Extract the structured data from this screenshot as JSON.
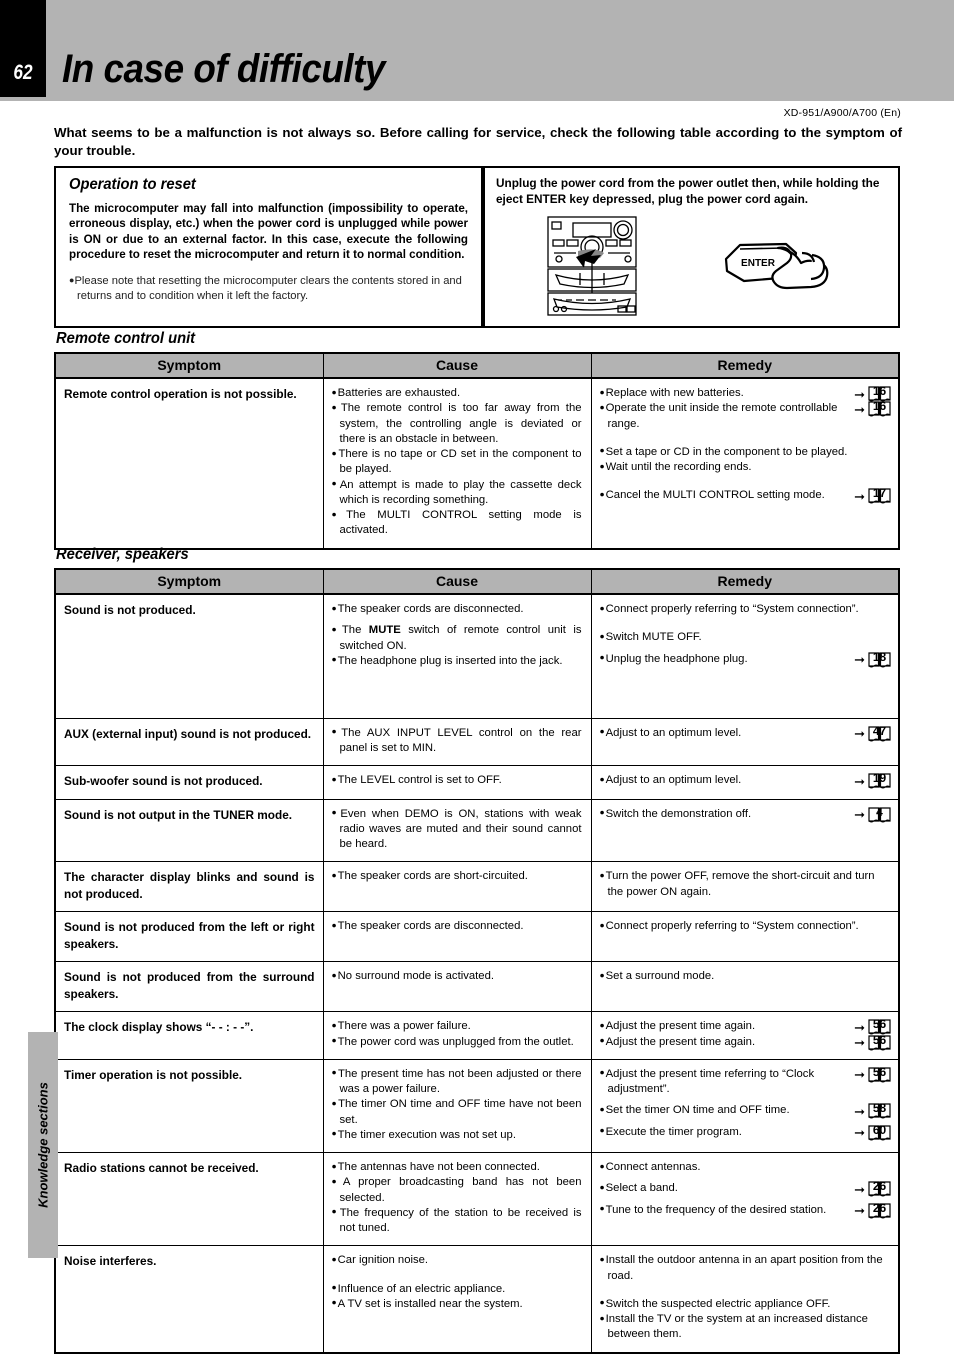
{
  "header": {
    "page_number": "62",
    "title": "In case of difficulty",
    "model_line": "XD-951/A900/A700 (En)"
  },
  "intro": "What seems to be a malfunction is not always so.  Before calling for service, check the following table according to the symptom of your trouble.",
  "reset_panel": {
    "heading": "Operation to reset",
    "body": "The microcomputer may fall into malfunction (impossibility to operate, erroneous display, etc.) when the power cord is unplugged while power is ON or due to an external factor. In this case, execute the following procedure to reset the microcomputer and return it to normal condition.",
    "note": "Please note that resetting the microcomputer clears the contents stored in and returns and to condition when it left the factory.",
    "instruction": "Unplug the power cord from the power outlet then, while holding the eject ENTER key depressed, plug the power cord again.",
    "enter_key_label": "ENTER"
  },
  "side_tab": {
    "label": "Knowledge sections"
  },
  "columns": {
    "symptom": "Symptom",
    "cause": "Cause",
    "remedy": "Remedy"
  },
  "sections": [
    {
      "heading": "Remote control unit",
      "rows": [
        {
          "symptom": "Remote control operation is not possible.",
          "causes": [
            "Batteries are exhausted.",
            "The remote control is too far away from the system, the controlling angle is deviated or there is an obstacle in between.",
            "There is no tape or CD set in the component to be played.",
            "An attempt is made to play the cassette deck which is recording something.",
            "The MULTI CONTROL setting mode is activated."
          ],
          "remedies": [
            {
              "text": "Replace with new batteries.",
              "page": "16"
            },
            {
              "text": "Operate the unit inside the remote controllable range.",
              "page": "16"
            },
            {
              "text": "Set a tape or CD in the component to be played.",
              "page": ""
            },
            {
              "text": "Wait until the recording ends.",
              "page": ""
            },
            {
              "text": "Cancel the MULTI CONTROL setting mode.",
              "page": "17"
            }
          ]
        }
      ]
    },
    {
      "heading": "Receiver, speakers",
      "rows": [
        {
          "symptom": "Sound is not produced.",
          "causes": [
            "The speaker cords are disconnected.",
            "The MUTE switch of remote control unit is switched ON.",
            "The headphone plug is inserted into the jack."
          ],
          "remedies": [
            {
              "text": "Connect properly referring to “System connection”.",
              "page": ""
            },
            {
              "text": "Switch MUTE OFF.",
              "page": ""
            },
            {
              "text": "Unplug the headphone plug.",
              "page": "18"
            }
          ]
        },
        {
          "symptom": "AUX (external input) sound is not produced.",
          "causes": [
            "The AUX INPUT LEVEL control on the rear panel is set to MIN."
          ],
          "remedies": [
            {
              "text": "Adjust to an optimum level.",
              "page": "47"
            }
          ]
        },
        {
          "symptom": "Sub-woofer sound is not produced.",
          "causes": [
            "The LEVEL control is set to OFF."
          ],
          "remedies": [
            {
              "text": "Adjust to an optimum level.",
              "page": "19"
            }
          ]
        },
        {
          "symptom": "Sound is not output in the TUNER mode.",
          "causes": [
            "Even when DEMO is ON, stations with weak radio waves are muted and their sound cannot be heard."
          ],
          "remedies": [
            {
              "text": "Switch the demonstration off.",
              "page": "4"
            }
          ]
        },
        {
          "symptom": "The character display blinks and sound is not produced.",
          "causes": [
            "The speaker cords are short-circuited."
          ],
          "remedies": [
            {
              "text": "Turn the power OFF, remove the short-circuit  and turn the power ON again.",
              "page": ""
            }
          ]
        },
        {
          "symptom": "Sound is not produced from the left or right speakers.",
          "causes": [
            "The speaker cords are disconnected."
          ],
          "remedies": [
            {
              "text": "Connect properly referring to “System connection”.",
              "page": ""
            }
          ]
        },
        {
          "symptom": "Sound is not produced from the surround speakers.",
          "causes": [
            "No surround mode is activated."
          ],
          "remedies": [
            {
              "text": "Set a surround mode.",
              "page": ""
            }
          ]
        },
        {
          "symptom": "The clock display shows “- - : - -”.",
          "causes": [
            "There was a power failure.",
            "The power cord was unplugged from the outlet."
          ],
          "remedies": [
            {
              "text": "Adjust the present time again.",
              "page": "56"
            },
            {
              "text": "Adjust the present time again.",
              "page": "56"
            }
          ]
        },
        {
          "symptom": "Timer operation is not possible.",
          "causes": [
            "The present time has not been adjusted or there was a power failure.",
            "The timer ON time and OFF time have not been set.",
            "The timer execution was not set up."
          ],
          "remedies": [
            {
              "text": "Adjust the present time referring to “Clock adjustment”.",
              "page": "56"
            },
            {
              "text": "Set the timer ON time and OFF time.",
              "page": "58"
            },
            {
              "text": "Execute the timer program.",
              "page": "60"
            }
          ]
        },
        {
          "symptom": "Radio stations cannot be received.",
          "causes": [
            "The antennas have not been connected.",
            "A proper broadcasting band has not been selected.",
            "The frequency of the station to be received is not tuned."
          ],
          "remedies": [
            {
              "text": "Connect antennas.",
              "page": ""
            },
            {
              "text": "Select a band.",
              "page": "26"
            },
            {
              "text": "Tune to the frequency of the desired station.",
              "page": "26"
            }
          ]
        },
        {
          "symptom": "Noise interferes.",
          "causes": [
            "Car ignition noise.",
            "Influence of an electric appliance.",
            "A TV set is installed near the system."
          ],
          "remedies": [
            {
              "text": "Install the outdoor antenna in an apart position from the road.",
              "page": ""
            },
            {
              "text": "Switch the suspected electric appliance OFF.",
              "page": ""
            },
            {
              "text": "Install the TV or the system at an increased distance between them.",
              "page": ""
            }
          ]
        }
      ]
    }
  ]
}
